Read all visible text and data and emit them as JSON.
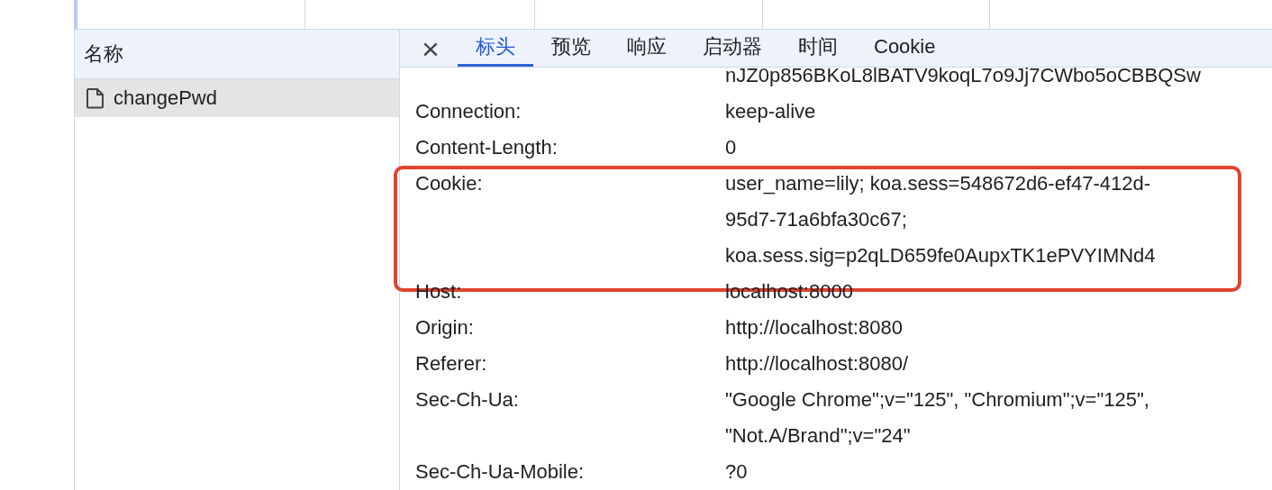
{
  "requests_panel": {
    "column_header": "名称",
    "items": [
      {
        "name": "changePwd",
        "selected": true
      }
    ]
  },
  "details": {
    "close": "×",
    "tabs": [
      {
        "label": "标头",
        "selected": true
      },
      {
        "label": "预览",
        "selected": false
      },
      {
        "label": "响应",
        "selected": false
      },
      {
        "label": "启动器",
        "selected": false
      },
      {
        "label": "时间",
        "selected": false
      },
      {
        "label": "Cookie",
        "selected": false
      }
    ],
    "headers": [
      {
        "value_lines": [
          "nJZ0p856BKoL8lBATV9koqL7o9Jj7CWbo5oCBBQSw"
        ],
        "highlighted": false
      },
      {
        "name": "Connection:",
        "value_lines": [
          "keep-alive"
        ],
        "highlighted": false
      },
      {
        "name": "Content-Length:",
        "value_lines": [
          "0"
        ],
        "highlighted": false
      },
      {
        "name": "Cookie:",
        "value_lines": [
          "user_name=lily; koa.sess=548672d6-ef47-412d-",
          "95d7-71a6bfa30c67;",
          "koa.sess.sig=p2qLD659fe0AupxTK1ePVYIMNd4"
        ],
        "highlighted": true
      },
      {
        "name": "Host:",
        "value_lines": [
          "localhost:8000"
        ],
        "highlighted": false
      },
      {
        "name": "Origin:",
        "value_lines": [
          "http://localhost:8080"
        ],
        "highlighted": false
      },
      {
        "name": "Referer:",
        "value_lines": [
          "http://localhost:8080/"
        ],
        "highlighted": false
      },
      {
        "name": "Sec-Ch-Ua:",
        "value_lines": [
          "\"Google Chrome\";v=\"125\", \"Chromium\";v=\"125\",",
          "\"Not.A/Brand\";v=\"24\""
        ],
        "highlighted": false
      },
      {
        "name": "Sec-Ch-Ua-Mobile:",
        "value_lines": [
          "?0"
        ],
        "highlighted": false
      }
    ]
  }
}
